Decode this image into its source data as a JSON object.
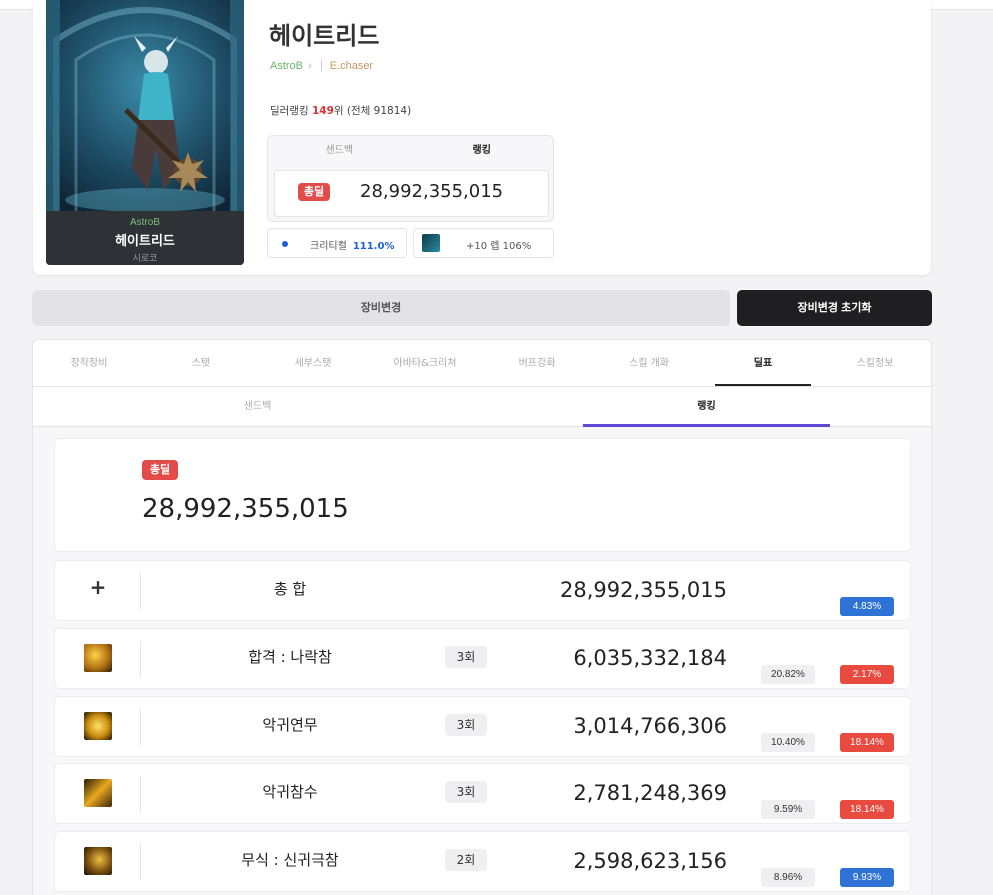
{
  "character": {
    "name": "헤이트리드",
    "adventure": "AstroB",
    "guild": "E.chaser",
    "job": "시로코",
    "ranking_label": "딜러랭킹",
    "ranking_value": "149",
    "ranking_unit": "위",
    "ranking_total": "(전체 91814)"
  },
  "damage_box": {
    "tabs": [
      "샌드백",
      "랭킹"
    ],
    "active_tab": "랭킹",
    "total_badge": "총딜",
    "total_value": "28,992,355,015"
  },
  "mini_stats": {
    "crit_label": "크리티컬",
    "crit_value": "111.0%",
    "element_label": "+10 렙 106%"
  },
  "buttons": {
    "change": "장비변경",
    "reset": "장비변경 초기화"
  },
  "tabs": [
    "장착장비",
    "스탯",
    "세부스탯",
    "아바타&크리쳐",
    "버프강화",
    "스킬 개화",
    "딜표",
    "스킬정보"
  ],
  "active_tab": "딜표",
  "subtabs": [
    "샌드백",
    "랭킹"
  ],
  "active_subtab": "랭킹",
  "total_card": {
    "badge": "총딜",
    "value": "28,992,355,015"
  },
  "rows": [
    {
      "skill": "총 합",
      "count": "",
      "damage": "28,992,355,015",
      "share": "",
      "change": "4.83%",
      "change_color": "blue",
      "icon": "plus-icon"
    },
    {
      "skill": "합격 : 나락참",
      "count": "3회",
      "damage": "6,035,332,184",
      "share": "20.82%",
      "change": "2.17%",
      "change_color": "red",
      "icon": "skill-naracham-icon"
    },
    {
      "skill": "악귀연무",
      "count": "3회",
      "damage": "3,014,766,306",
      "share": "10.40%",
      "change": "18.14%",
      "change_color": "red",
      "icon": "skill-akgwiyeonmu-icon"
    },
    {
      "skill": "악귀참수",
      "count": "3회",
      "damage": "2,781,248,369",
      "share": "9.59%",
      "change": "18.14%",
      "change_color": "red",
      "icon": "skill-akgwichamsu-icon"
    },
    {
      "skill": "무식 : 신귀극참",
      "count": "2회",
      "damage": "2,598,623,156",
      "share": "8.96%",
      "change": "9.93%",
      "change_color": "blue",
      "icon": "skill-singwigeukcham-icon"
    }
  ]
}
